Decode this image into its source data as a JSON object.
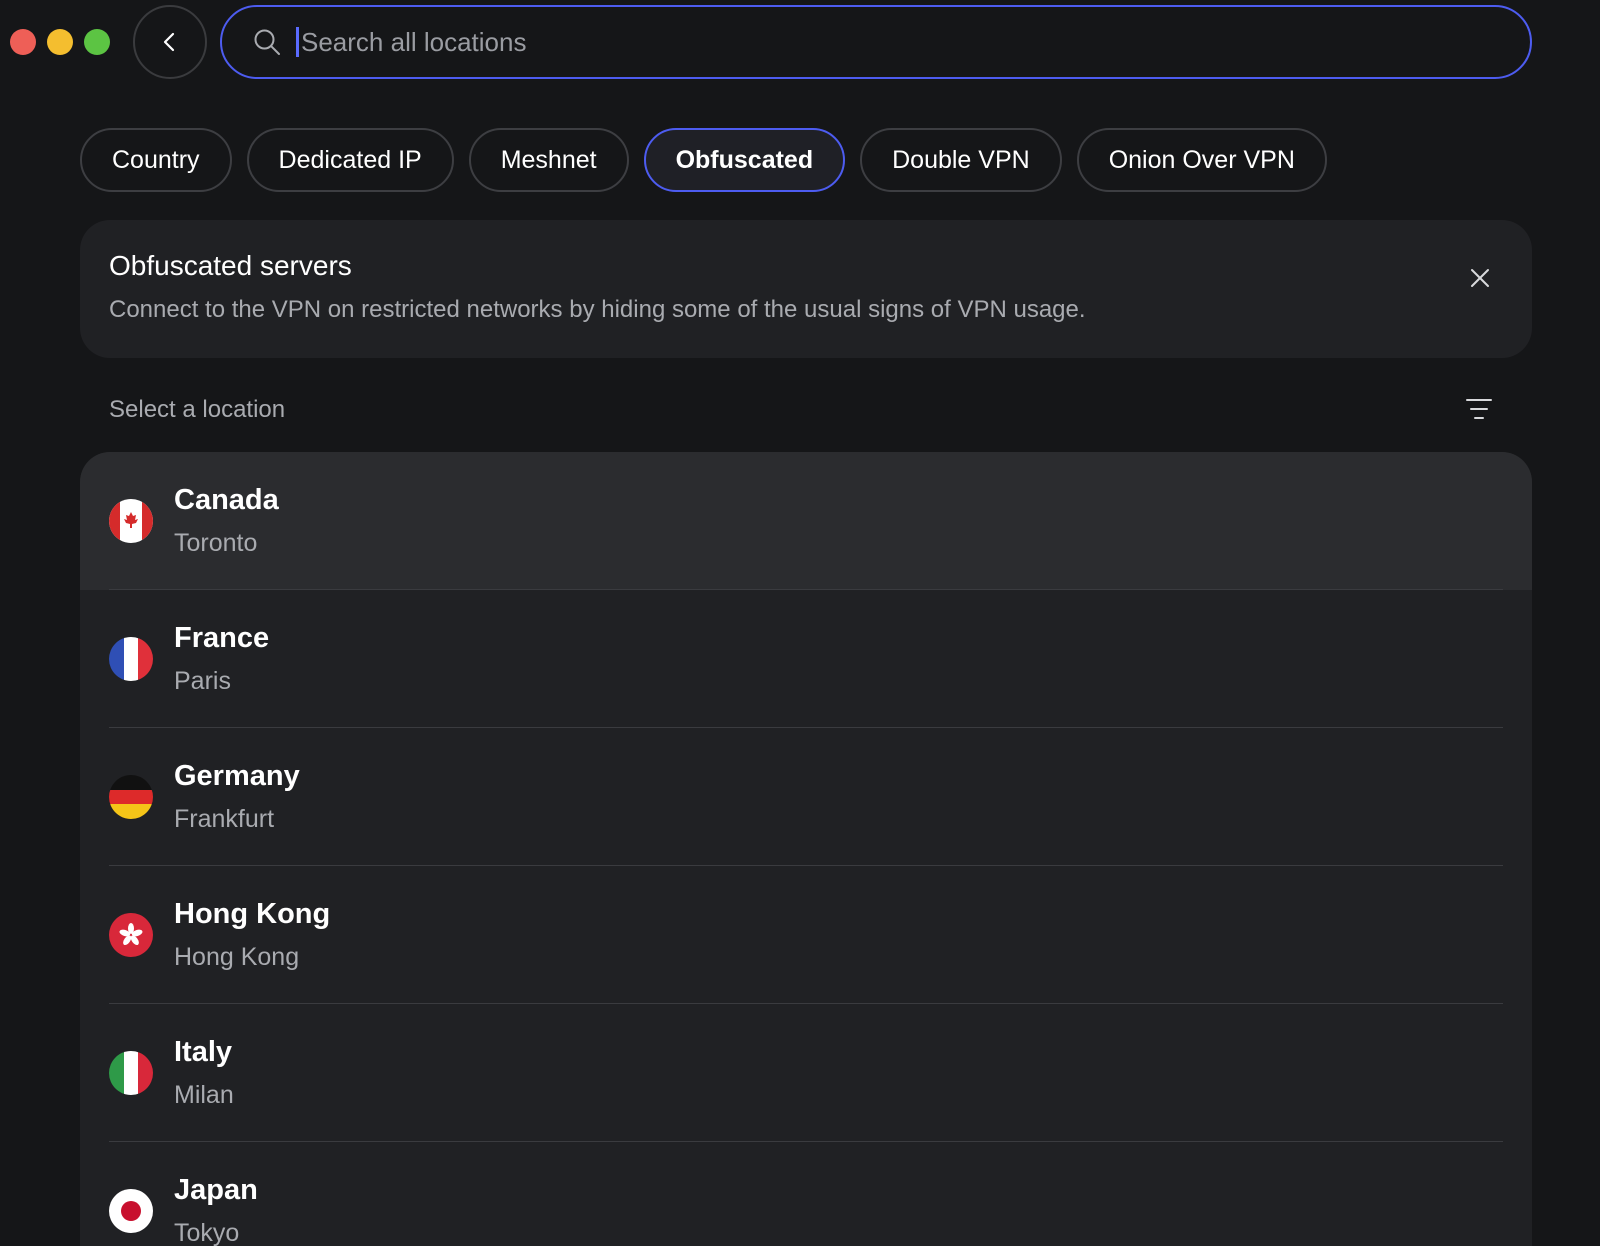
{
  "window_controls": [
    "close",
    "minimize",
    "maximize"
  ],
  "back_icon": "chevron-left-icon",
  "search": {
    "placeholder": "Search all locations",
    "value": "",
    "icon": "search-icon"
  },
  "tabs": [
    {
      "label": "Country",
      "active": false
    },
    {
      "label": "Dedicated IP",
      "active": false
    },
    {
      "label": "Meshnet",
      "active": false
    },
    {
      "label": "Obfuscated",
      "active": true
    },
    {
      "label": "Double VPN",
      "active": false
    },
    {
      "label": "Onion Over VPN",
      "active": false
    }
  ],
  "info_card": {
    "title": "Obfuscated servers",
    "description": "Connect to the VPN on restricted networks by hiding some of the usual signs of VPN usage.",
    "close_icon": "close-icon"
  },
  "section": {
    "label": "Select a location",
    "sort_icon": "sort-icon"
  },
  "locations": [
    {
      "country": "Canada",
      "city": "Toronto",
      "flag": "canada-flag-icon"
    },
    {
      "country": "France",
      "city": "Paris",
      "flag": "france-flag-icon"
    },
    {
      "country": "Germany",
      "city": "Frankfurt",
      "flag": "germany-flag-icon"
    },
    {
      "country": "Hong Kong",
      "city": "Hong Kong",
      "flag": "hong-kong-flag-icon"
    },
    {
      "country": "Italy",
      "city": "Milan",
      "flag": "italy-flag-icon"
    },
    {
      "country": "Japan",
      "city": "Tokyo",
      "flag": "japan-flag-icon"
    }
  ],
  "colors": {
    "background": "#151618",
    "card": "#202124",
    "accent": "#4d5cf0",
    "text_secondary": "#a9abb0"
  }
}
